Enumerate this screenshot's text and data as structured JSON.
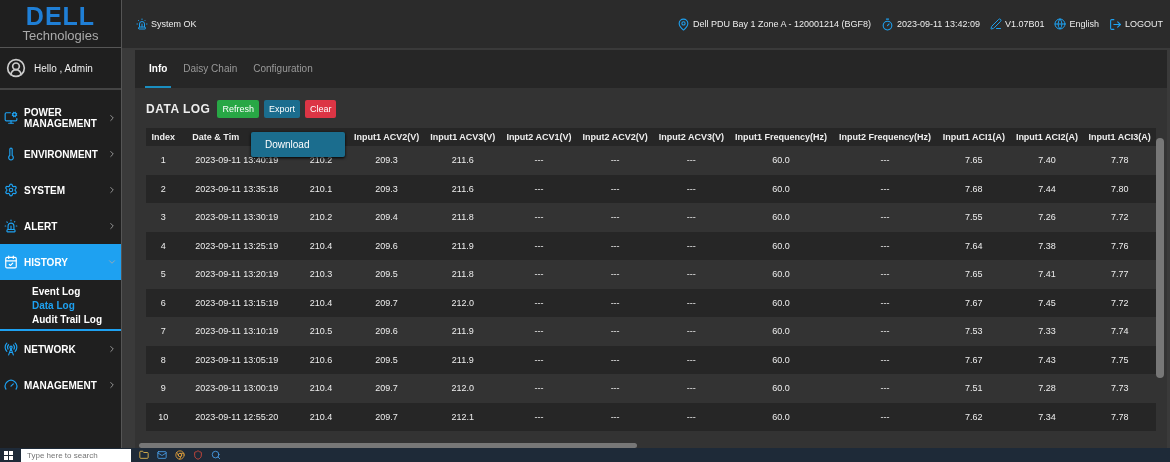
{
  "brand": {
    "name": "DELL",
    "tagline": "Technologies"
  },
  "header": {
    "status": "System OK",
    "device": "Dell PDU Bay 1 Zone A - 120001214 (BGF8)",
    "datetime": "2023-09-11 13:42:09",
    "version": "V1.07B01",
    "language": "English",
    "logout": "LOGOUT"
  },
  "sidebar": {
    "greeting": "Hello , Admin",
    "items": [
      {
        "label": "POWER MANAGEMENT",
        "selected": false,
        "expanded": false
      },
      {
        "label": "ENVIRONMENT",
        "selected": false,
        "expanded": false
      },
      {
        "label": "SYSTEM",
        "selected": false,
        "expanded": false
      },
      {
        "label": "ALERT",
        "selected": false,
        "expanded": false
      },
      {
        "label": "HISTORY",
        "selected": true,
        "expanded": true,
        "children": [
          {
            "label": "Event Log",
            "selected": false
          },
          {
            "label": "Data Log",
            "selected": true
          },
          {
            "label": "Audit Trail Log",
            "selected": false
          }
        ]
      },
      {
        "label": "NETWORK",
        "selected": false,
        "expanded": false
      },
      {
        "label": "MANAGEMENT",
        "selected": false,
        "expanded": false
      }
    ]
  },
  "tabs": [
    {
      "label": "Info",
      "selected": true
    },
    {
      "label": "Daisy Chain",
      "selected": false
    },
    {
      "label": "Configuration",
      "selected": false
    }
  ],
  "section_title": "DATA LOG",
  "buttons": [
    {
      "label": "Refresh",
      "kind": "refresh"
    },
    {
      "label": "Export",
      "kind": "export"
    },
    {
      "label": "Clear",
      "kind": "clear"
    }
  ],
  "export_menu": {
    "open": true,
    "items": [
      "Download"
    ]
  },
  "table": {
    "columns": [
      {
        "label": "Index"
      },
      {
        "label": "Date & Tim"
      },
      {},
      {
        "label": "Input1 ACV2(V)"
      },
      {
        "label": "Input1 ACV3(V)"
      },
      {
        "label": "Input2 ACV1(V)"
      },
      {
        "label": "Input2 ACV2(V)"
      },
      {
        "label": "Input2 ACV3(V)"
      },
      {
        "label": "Input1 Frequency(Hz)"
      },
      {
        "label": "Input2 Frequency(Hz)"
      },
      {
        "label": "Input1 ACI1(A)"
      },
      {
        "label": "Input1 ACI2(A)"
      },
      {
        "label": "Input1 ACI3(A)"
      }
    ],
    "rows": [
      [
        "1",
        "2023-09-11 13:40:19",
        "210.2",
        "209.3",
        "211.6",
        "---",
        "---",
        "---",
        "60.0",
        "---",
        "7.65",
        "7.40",
        "7.78"
      ],
      [
        "2",
        "2023-09-11 13:35:18",
        "210.1",
        "209.3",
        "211.6",
        "---",
        "---",
        "---",
        "60.0",
        "---",
        "7.68",
        "7.44",
        "7.80"
      ],
      [
        "3",
        "2023-09-11 13:30:19",
        "210.2",
        "209.4",
        "211.8",
        "---",
        "---",
        "---",
        "60.0",
        "---",
        "7.55",
        "7.26",
        "7.72"
      ],
      [
        "4",
        "2023-09-11 13:25:19",
        "210.4",
        "209.6",
        "211.9",
        "---",
        "---",
        "---",
        "60.0",
        "---",
        "7.64",
        "7.38",
        "7.76"
      ],
      [
        "5",
        "2023-09-11 13:20:19",
        "210.3",
        "209.5",
        "211.8",
        "---",
        "---",
        "---",
        "60.0",
        "---",
        "7.65",
        "7.41",
        "7.77"
      ],
      [
        "6",
        "2023-09-11 13:15:19",
        "210.4",
        "209.7",
        "212.0",
        "---",
        "---",
        "---",
        "60.0",
        "---",
        "7.67",
        "7.45",
        "7.72"
      ],
      [
        "7",
        "2023-09-11 13:10:19",
        "210.5",
        "209.6",
        "211.9",
        "---",
        "---",
        "---",
        "60.0",
        "---",
        "7.53",
        "7.33",
        "7.74"
      ],
      [
        "8",
        "2023-09-11 13:05:19",
        "210.6",
        "209.5",
        "211.9",
        "---",
        "---",
        "---",
        "60.0",
        "---",
        "7.67",
        "7.43",
        "7.75"
      ],
      [
        "9",
        "2023-09-11 13:00:19",
        "210.4",
        "209.7",
        "212.0",
        "---",
        "---",
        "---",
        "60.0",
        "---",
        "7.51",
        "7.28",
        "7.73"
      ],
      [
        "10",
        "2023-09-11 12:55:20",
        "210.4",
        "209.7",
        "212.1",
        "---",
        "---",
        "---",
        "60.0",
        "---",
        "7.62",
        "7.34",
        "7.78"
      ]
    ]
  },
  "taskbar": {
    "search_placeholder": "Type here to search"
  }
}
